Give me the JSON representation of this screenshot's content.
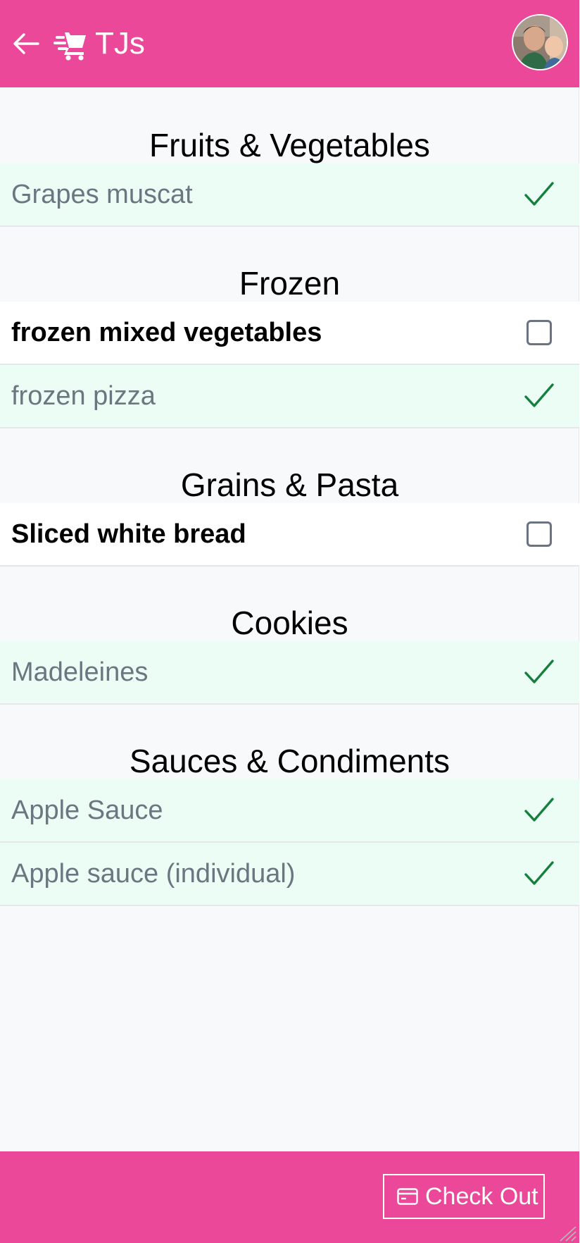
{
  "header": {
    "title": "TJs",
    "back_icon": "arrow-left-icon",
    "cart_icon": "fast-cart-icon",
    "avatar": "user-avatar-photo",
    "background_color": "#ec4899"
  },
  "sections": [
    {
      "title": "Fruits & Vegetables",
      "items": [
        {
          "name": "Grapes muscat",
          "checked": true
        }
      ]
    },
    {
      "title": "Frozen",
      "items": [
        {
          "name": "frozen mixed vegetables",
          "checked": false
        },
        {
          "name": "frozen pizza",
          "checked": true
        }
      ]
    },
    {
      "title": "Grains & Pasta",
      "items": [
        {
          "name": "Sliced white bread",
          "checked": false
        }
      ]
    },
    {
      "title": "Cookies",
      "items": [
        {
          "name": "Madeleines",
          "checked": true
        }
      ]
    },
    {
      "title": "Sauces & Condiments",
      "items": [
        {
          "name": "Apple Sauce",
          "checked": true
        },
        {
          "name": "Apple sauce (individual)",
          "checked": true
        }
      ]
    }
  ],
  "footer": {
    "checkout_label": "Check Out",
    "checkout_icon": "credit-card-icon"
  },
  "colors": {
    "accent": "#ec4899",
    "checked_row": "#ecfdf5",
    "checkmark": "#15803d",
    "checked_text": "#6b7780"
  }
}
